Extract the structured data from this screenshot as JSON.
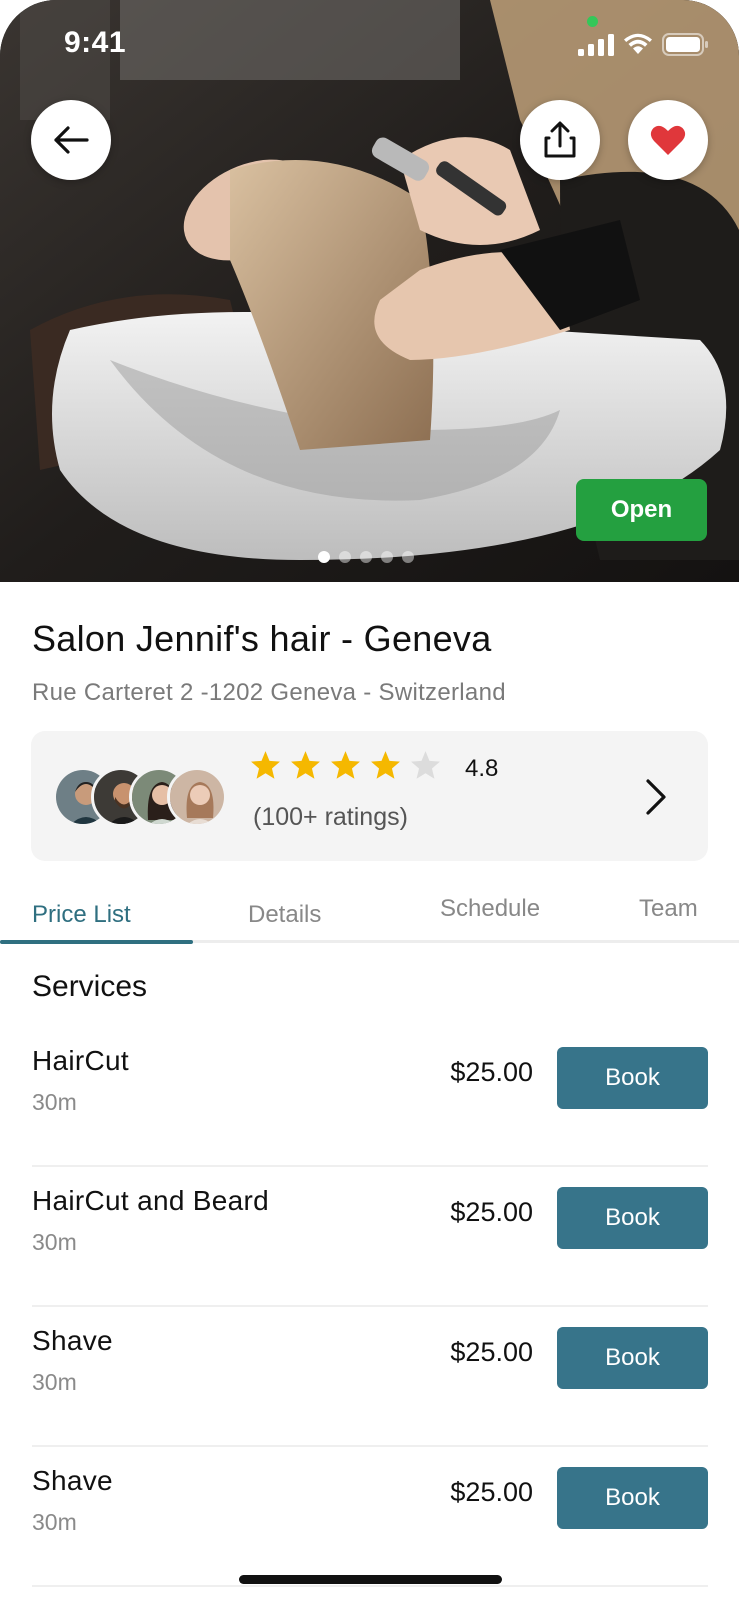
{
  "status_bar": {
    "time": "9:41"
  },
  "hero": {
    "open_badge": "Open",
    "pager": {
      "count": 5,
      "active": 0
    }
  },
  "salon": {
    "name": "Salon Jennif's hair - Geneva",
    "address": "Rue Carteret 2 -1202 Geneva - Switzerland"
  },
  "rating": {
    "value": "4.8",
    "stars_filled": 4,
    "stars_total": 5,
    "count_label": "(100+ ratings)"
  },
  "tabs": [
    {
      "label": "Price List",
      "active": true
    },
    {
      "label": "Details",
      "active": false
    },
    {
      "label": "Schedule",
      "active": false
    },
    {
      "label": "Team",
      "active": false
    }
  ],
  "services": {
    "title": "Services",
    "items": [
      {
        "name": "HairCut",
        "duration": "30m",
        "price": "$25.00",
        "book_label": "Book"
      },
      {
        "name": "HairCut and Beard",
        "duration": "30m",
        "price": "$25.00",
        "book_label": "Book"
      },
      {
        "name": "Shave",
        "duration": "30m",
        "price": "$25.00",
        "book_label": "Book"
      },
      {
        "name": "Shave",
        "duration": "30m",
        "price": "$25.00",
        "book_label": "Book"
      }
    ]
  },
  "colors": {
    "accent": "#2f6f80",
    "book_button": "#37748a",
    "open_badge": "#24a040",
    "star": "#f5b800",
    "heart": "#e0373b"
  }
}
